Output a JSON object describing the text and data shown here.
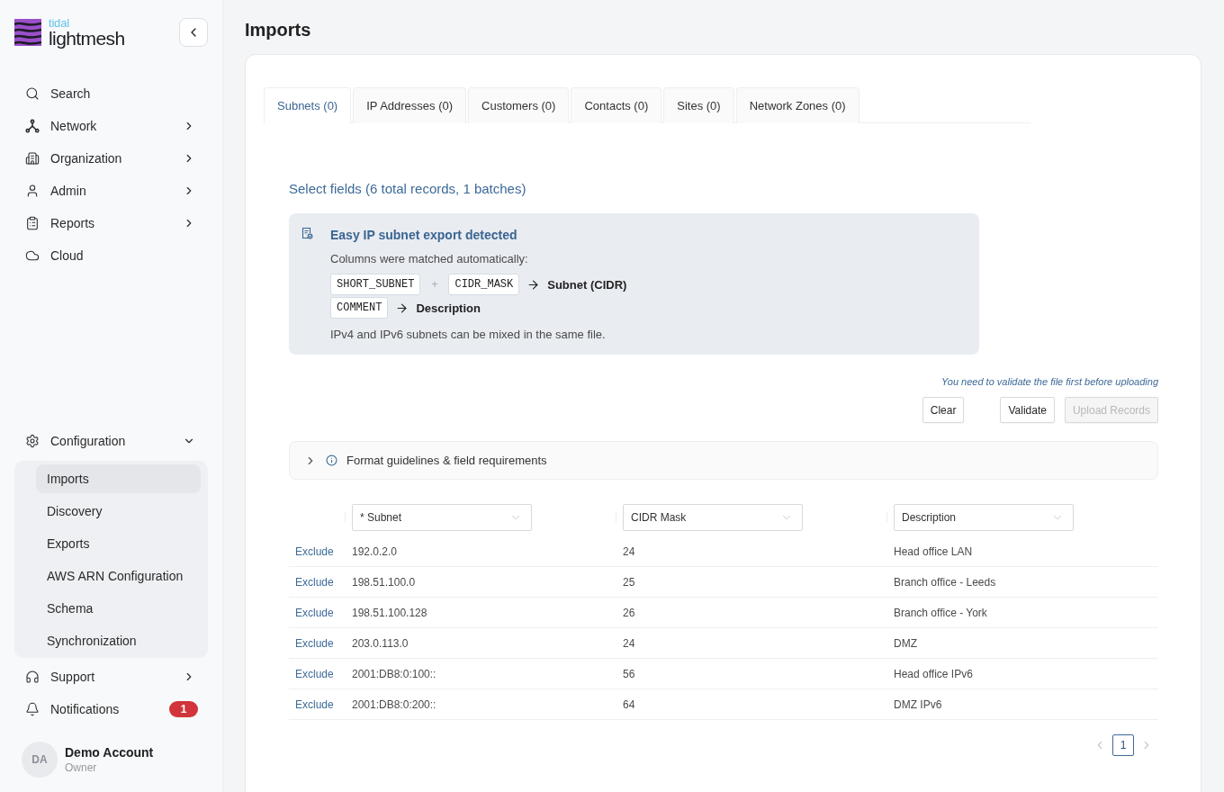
{
  "sidebar": {
    "brand": {
      "tagline": "tidal",
      "name": "lightmesh"
    },
    "nav_top": [
      {
        "kind": "link",
        "label": "Search"
      },
      {
        "kind": "menu",
        "label": "Network",
        "expanded": false
      },
      {
        "kind": "menu",
        "label": "Organization",
        "expanded": false
      },
      {
        "kind": "menu",
        "label": "Admin",
        "expanded": false
      },
      {
        "kind": "menu",
        "label": "Reports",
        "expanded": false
      },
      {
        "kind": "link",
        "label": "Cloud"
      }
    ],
    "nav_bottom": [
      {
        "kind": "menu",
        "label": "Configuration",
        "expanded": true,
        "children": [
          {
            "label": "Imports",
            "selected": true
          },
          {
            "label": "Discovery",
            "selected": false
          },
          {
            "label": "Exports",
            "selected": false
          },
          {
            "label": "AWS ARN Configuration",
            "selected": false
          },
          {
            "label": "Schema",
            "selected": false
          },
          {
            "label": "Synchronization",
            "selected": false
          }
        ]
      },
      {
        "kind": "menu",
        "label": "Support",
        "expanded": false
      },
      {
        "kind": "link",
        "label": "Notifications",
        "badge": "1"
      }
    ],
    "account": {
      "initials": "DA",
      "name": "Demo Account",
      "role": "Owner"
    }
  },
  "page_title": "Imports",
  "tabs": [
    {
      "label": "Subnets (0)",
      "selected": true
    },
    {
      "label": "IP Addresses (0)",
      "selected": false
    },
    {
      "label": "Customers (0)",
      "selected": false
    },
    {
      "label": "Contacts (0)",
      "selected": false
    },
    {
      "label": "Sites (0)",
      "selected": false
    },
    {
      "label": "Network Zones (0)",
      "selected": false
    }
  ],
  "heading": "Select fields (6 total records, 1 batches)",
  "notice": {
    "title": "Easy IP subnet export detected",
    "intro": "Columns were matched automatically:",
    "mappings": [
      {
        "sources": [
          "SHORT_SUBNET",
          "CIDR_MASK"
        ],
        "joiner": "+",
        "target": "Subnet (CIDR)"
      },
      {
        "sources": [
          "COMMENT"
        ],
        "target": "Description"
      }
    ],
    "note": "IPv4 and IPv6 subnets can be mixed in the same file."
  },
  "validation_hint": "You need to validate the file first before uploading",
  "actions": {
    "left": [
      {
        "label": "Clear",
        "disabled": false
      }
    ],
    "right": [
      {
        "label": "Validate",
        "disabled": false
      },
      {
        "label": "Upload Records",
        "disabled": true
      }
    ]
  },
  "guidelines": {
    "label": "Format guidelines & field requirements",
    "expanded": false
  },
  "table": {
    "columns": [
      {
        "label": "* Subnet"
      },
      {
        "label": "CIDR Mask"
      },
      {
        "label": "Description"
      }
    ],
    "rows": [
      {
        "action": "Exclude",
        "cells": [
          "192.0.2.0",
          "24",
          "Head office LAN"
        ]
      },
      {
        "action": "Exclude",
        "cells": [
          "198.51.100.0",
          "25",
          "Branch office - Leeds"
        ]
      },
      {
        "action": "Exclude",
        "cells": [
          "198.51.100.128",
          "26",
          "Branch office - York"
        ]
      },
      {
        "action": "Exclude",
        "cells": [
          "203.0.113.0",
          "24",
          "DMZ"
        ]
      },
      {
        "action": "Exclude",
        "cells": [
          "2001:DB8:0:100::",
          "56",
          "Head office IPv6"
        ]
      },
      {
        "action": "Exclude",
        "cells": [
          "2001:DB8:0:200::",
          "64",
          "DMZ IPv6"
        ]
      }
    ]
  },
  "pagination": {
    "previous": {
      "disabled": true
    },
    "pages": [
      {
        "label": "1",
        "selected": true
      }
    ],
    "next": {
      "disabled": true
    }
  }
}
